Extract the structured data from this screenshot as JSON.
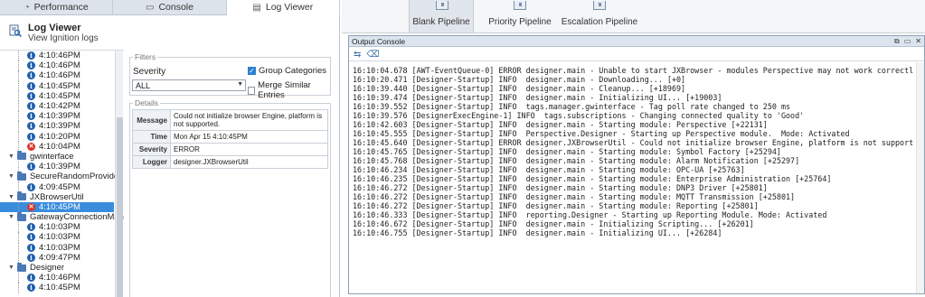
{
  "tabs": [
    {
      "label": "Performance",
      "icon": "performance-icon"
    },
    {
      "label": "Console",
      "icon": "console-icon"
    },
    {
      "label": "Log Viewer",
      "icon": "log-viewer-icon"
    }
  ],
  "header": {
    "title": "Log Viewer",
    "subtitle": "View Ignition logs"
  },
  "tree": {
    "top_entries": [
      {
        "time": "4:10:46PM",
        "level": "info"
      },
      {
        "time": "4:10:46PM",
        "level": "info"
      },
      {
        "time": "4:10:46PM",
        "level": "info"
      },
      {
        "time": "4:10:45PM",
        "level": "info"
      },
      {
        "time": "4:10:45PM",
        "level": "info"
      },
      {
        "time": "4:10:42PM",
        "level": "info"
      },
      {
        "time": "4:10:39PM",
        "level": "info"
      },
      {
        "time": "4:10:39PM",
        "level": "info"
      },
      {
        "time": "4:10:20PM",
        "level": "info"
      },
      {
        "time": "4:10:04PM",
        "level": "error"
      }
    ],
    "groups": [
      {
        "name": "gwinterface",
        "entries": [
          {
            "time": "4:10:39PM",
            "level": "info"
          }
        ]
      },
      {
        "name": "SecureRandomProvider",
        "entries": [
          {
            "time": "4:09:45PM",
            "level": "info"
          }
        ]
      },
      {
        "name": "JXBrowserUtil",
        "entries": [
          {
            "time": "4:10:45PM",
            "level": "error",
            "selected": true
          }
        ]
      },
      {
        "name": "GatewayConnectionManag",
        "entries": [
          {
            "time": "4:10:03PM",
            "level": "info"
          },
          {
            "time": "4:10:03PM",
            "level": "info"
          },
          {
            "time": "4:10:03PM",
            "level": "info"
          },
          {
            "time": "4:09:47PM",
            "level": "info"
          }
        ]
      },
      {
        "name": "Designer",
        "entries": [
          {
            "time": "4:10:46PM",
            "level": "info"
          },
          {
            "time": "4:10:45PM",
            "level": "info"
          }
        ]
      }
    ]
  },
  "filters": {
    "legend": "Filters",
    "severity_label": "Severity",
    "severity_value": "ALL",
    "group_categories": {
      "label": "Group Categories",
      "checked": true
    },
    "merge_similar": {
      "label": "Merge Similar Entries",
      "checked": false
    }
  },
  "details": {
    "legend": "Details",
    "rows": [
      {
        "key": "Message",
        "value": "Could not initialize browser Engine, platform is not supported."
      },
      {
        "key": "Time",
        "value": "Mon Apr 15 4:10:45PM"
      },
      {
        "key": "Severity",
        "value": "ERROR"
      },
      {
        "key": "Logger",
        "value": "designer.JXBrowserUtil"
      }
    ]
  },
  "pipelines": [
    {
      "label": "Blank Pipeline",
      "active": true
    },
    {
      "label": "Priority Pipeline",
      "active": false
    },
    {
      "label": "Escalation Pipeline",
      "active": false
    }
  ],
  "console": {
    "title": "Output Console",
    "lines": [
      "16:10:04.678 [AWT-EventQueue-0] ERROR designer.main - Unable to start JXBrowser - modules Perspective may not work correctly",
      "16:10:20.471 [Designer-Startup] INFO  designer.main - Downloading... [+0]",
      "16:10:39.440 [Designer-Startup] INFO  designer.main - Cleanup... [+18969]",
      "16:10:39.474 [Designer-Startup] INFO  designer.main - Initializing UI... [+19003]",
      "16:10:39.552 [Designer-Startup] INFO  tags.manager.gwinterface - Tag poll rate changed to 250 ms",
      "16:10:39.576 [DesignerExecEngine-1] INFO  tags.subscriptions - Changing connected quality to 'Good'",
      "16:10:42.603 [Designer-Startup] INFO  designer.main - Starting module: Perspective [+22131]",
      "16:10:45.555 [Designer-Startup] INFO  Perspective.Designer - Starting up Perspective module.  Mode: Activated",
      "16:10:45.640 [Designer-Startup] ERROR designer.JXBrowserUtil - Could not initialize browser Engine, platform is not supported.",
      "16:10:45.765 [Designer-Startup] INFO  designer.main - Starting module: Symbol Factory [+25294]",
      "16:10:45.768 [Designer-Startup] INFO  designer.main - Starting module: Alarm Notification [+25297]",
      "16:10:46.234 [Designer-Startup] INFO  designer.main - Starting module: OPC-UA [+25763]",
      "16:10:46.235 [Designer-Startup] INFO  designer.main - Starting module: Enterprise Administration [+25764]",
      "16:10:46.272 [Designer-Startup] INFO  designer.main - Starting module: DNP3 Driver [+25801]",
      "16:10:46.272 [Designer-Startup] INFO  designer.main - Starting module: MQTT Transmission [+25801]",
      "16:10:46.272 [Designer-Startup] INFO  designer.main - Starting module: Reporting [+25801]",
      "16:10:46.333 [Designer-Startup] INFO  reporting.Designer - Starting up Reporting Module. Mode: Activated",
      "16:10:46.672 [Designer-Startup] INFO  designer.main - Initializing Scripting... [+26201]",
      "16:10:46.755 [Designer-Startup] INFO  designer.main - Initializing UI... [+26284]"
    ]
  },
  "colors": {
    "selection": "#3a8ddd",
    "info": "#1e5fb0",
    "error": "#d9342b"
  }
}
